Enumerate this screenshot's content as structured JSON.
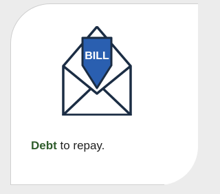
{
  "bill_label": "BILL",
  "caption": {
    "emphasis": "Debt",
    "rest": " to repay."
  },
  "colors": {
    "accent_green": "#2f5d2c",
    "bill_blue": "#2a5fb0",
    "outline_navy": "#1b2d44",
    "card_background": "#ffffff",
    "page_background": "#ececec"
  },
  "icons": [
    "open-envelope-icon"
  ]
}
